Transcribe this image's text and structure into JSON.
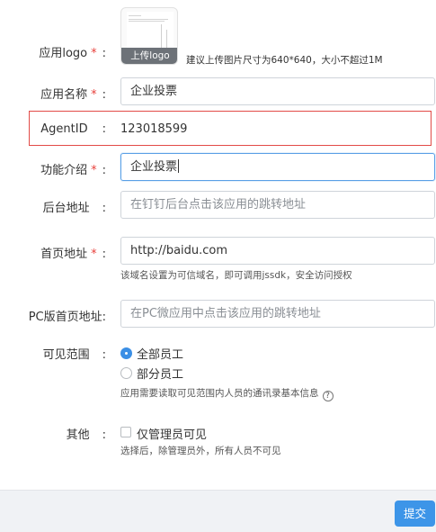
{
  "logo": {
    "label": "应用logo",
    "required_mark": "*",
    "upload_button": "上传logo",
    "hint": "建议上传图片尺寸为640*640，大小不超过1M"
  },
  "app_name": {
    "label": "应用名称",
    "required_mark": "*",
    "value": "企业投票"
  },
  "agent_id": {
    "label": "AgentID",
    "value": "123018599",
    "highlight_color": "#e24b47"
  },
  "description": {
    "label": "功能介绍",
    "required_mark": "*",
    "value": "企业投票"
  },
  "backend_url": {
    "label": "后台地址",
    "placeholder": "在钉钉后台点击该应用的跳转地址"
  },
  "homepage_url": {
    "label": "首页地址",
    "required_mark": "*",
    "value": "http://baidu.com",
    "hint": "该域名设置为可信域名，即可调用jssdk，安全访问授权"
  },
  "pc_homepage_url": {
    "label": "PC版首页地址:",
    "placeholder": "在PC微应用中点击该应用的跳转地址"
  },
  "visibility": {
    "label": "可见范围",
    "options": [
      {
        "label": "全部员工",
        "checked": true
      },
      {
        "label": "部分员工",
        "checked": false
      }
    ],
    "hint": "应用需要读取可见范围内人员的通讯录基本信息",
    "help_glyph": "?"
  },
  "other": {
    "label": "其他",
    "checkbox_label": "仅管理员可见",
    "checked": false,
    "hint": "选择后，除管理员外，所有人员不可见"
  },
  "colon": ":",
  "submit_label": "提交",
  "colors": {
    "primary": "#3d95e8",
    "required": "#e8413c"
  }
}
